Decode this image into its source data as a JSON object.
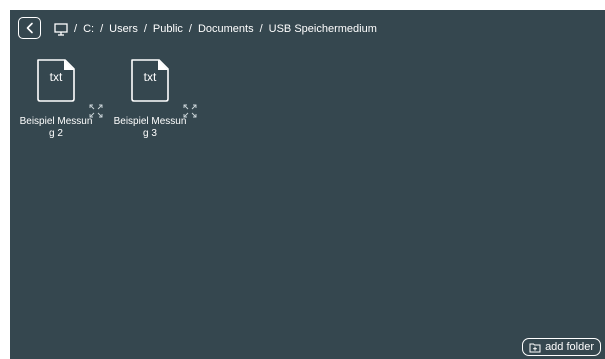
{
  "breadcrumb": {
    "root_icon": "computer-icon",
    "items": [
      "C:",
      "Users",
      "Public",
      "Documents",
      "USB Speichermedium"
    ],
    "separator": "/"
  },
  "files": [
    {
      "ext": "txt",
      "name": "Beispiel Messung 2",
      "icon": "file-icon"
    },
    {
      "ext": "txt",
      "name": "Beispiel Messung 3",
      "icon": "file-icon"
    }
  ],
  "actions": {
    "add_folder_label": "add folder",
    "add_folder_icon": "folder-plus-icon",
    "back_icon": "chevron-left-icon",
    "expand_icon": "expand-icon"
  },
  "colors": {
    "background": "#35474f",
    "foreground": "#ffffff"
  }
}
